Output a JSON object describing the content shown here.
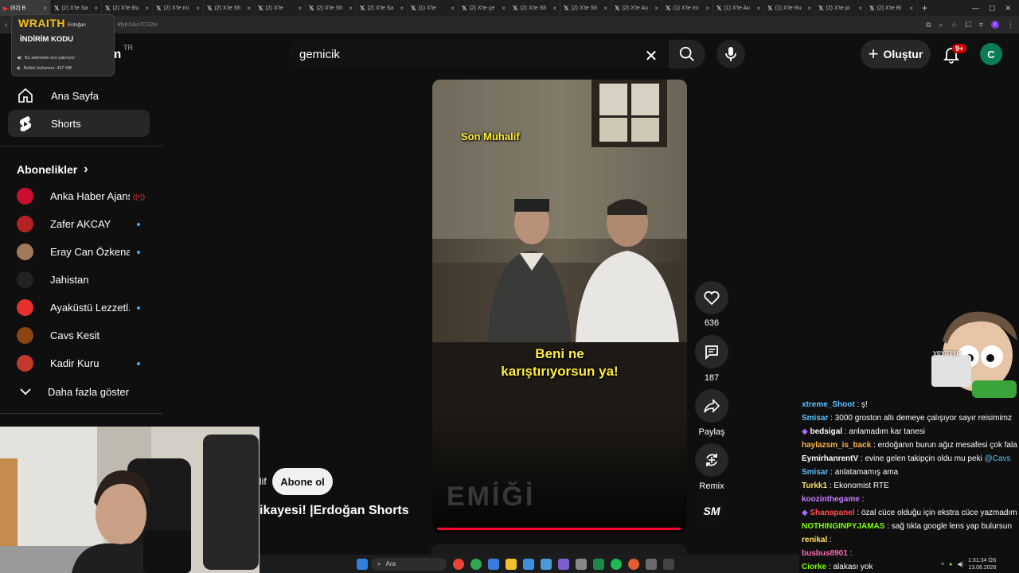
{
  "browser": {
    "tabs": [
      {
        "label": "(62) B",
        "active": true
      },
      {
        "label": "(2) X'te Sa"
      },
      {
        "label": "(2) X'te Bu"
      },
      {
        "label": "(2) X'te mi"
      },
      {
        "label": "(2) X'te Sh"
      },
      {
        "label": "(2) X'te"
      },
      {
        "label": "(2) X'te Sh"
      },
      {
        "label": "(2) X'te Sa"
      },
      {
        "label": "(1) X'te"
      },
      {
        "label": "(2) X'te çe"
      },
      {
        "label": "(2) X'te Sh"
      },
      {
        "label": "(2) X'te Sh"
      },
      {
        "label": "(2) X'te Au"
      },
      {
        "label": "(1) X'te mi"
      },
      {
        "label": "(1) X'te Au"
      },
      {
        "label": "(1) X'te Ru"
      },
      {
        "label": "(2) X'te pi"
      },
      {
        "label": "(2) X'te Bl"
      }
    ],
    "url_fragment": "8fyKDAo7CS2w"
  },
  "tab_tooltip": {
    "brand": "WRAITH",
    "promo": "İNDİRİM KODU",
    "title_fragment": "Erdoğan",
    "row_audio": "Bu sekmede ses çalınıyor",
    "row_memory": "Bellek kullanımı: 437 MB"
  },
  "youtube": {
    "logo_tail": "m",
    "region": "TR",
    "search_query": "gemicik",
    "create_label": "Oluştur",
    "notif_count": "9+",
    "avatar_letter": "C"
  },
  "sidebar": {
    "home_label": "Ana Sayfa",
    "shorts_label": "Shorts",
    "subs_heading": "Abonelikler",
    "subscriptions": [
      {
        "name": "Anka Haber Ajansı",
        "live": true,
        "color": "#c8102e"
      },
      {
        "name": "Zafer AKCAY",
        "dot": true,
        "color": "#b22222"
      },
      {
        "name": "Eray Can Özkenar",
        "dot": true,
        "color": "#a0785a"
      },
      {
        "name": "Jahistan",
        "color": "#222222"
      },
      {
        "name": "Ayaküstü Lezzetl...",
        "dot": true,
        "color": "#e63030"
      },
      {
        "name": "Cavs Kesit",
        "color": "#8b4513"
      },
      {
        "name": "Kadir Kuru",
        "dot": true,
        "color": "#c0392b"
      }
    ],
    "show_more": "Daha fazla göster"
  },
  "short": {
    "caption_top": "Son Muhalif",
    "caption_line1": "Beni ne",
    "caption_line2": "karıştırıyorsun ya!",
    "watermark": "EMİĞİ",
    "channel_fragment": "lif",
    "subscribe_label": "Abone ol",
    "title_fragment": "ikayesi! |Erdoğan Shorts",
    "likes": "636",
    "comments": "187",
    "share_label": "Paylaş",
    "remix_label": "Remix",
    "remix_badge": "SM"
  },
  "chat": {
    "mascot_label": "yevmiye",
    "messages": [
      {
        "user": "xtreme_Shoot",
        "text": "ş!",
        "color": "#5bc0ff"
      },
      {
        "user": "Smisar",
        "text": "3000 groston altı demeye çalışıyor sayır reisimimz",
        "color": "#5bc0ff"
      },
      {
        "user": "bedsigal",
        "text": "anlamadım kar tanesi",
        "color": "#ffffff",
        "badge": true
      },
      {
        "user": "haylazsm_is_back",
        "text": "erdoğanın burun ağız mesafesi çok fala",
        "color": "#ffb347"
      },
      {
        "user": "EymirhanrentV",
        "text": "evine gelen takipçin oldu mu peki",
        "mention": "@Cavs",
        "color": "#ffffff"
      },
      {
        "user": "Smisar",
        "text": "anlatamamış ama",
        "color": "#5bc0ff"
      },
      {
        "user": "Turkk1",
        "text": "Ekonomist RTE",
        "color": "#ffe066"
      },
      {
        "user": "koozinthegame",
        "text": "",
        "color": "#c77dff"
      },
      {
        "user": "Shanapanel",
        "text": "özal cüce olduğu için ekstra cüce yazmadım",
        "color": "#ff4d4d",
        "badge": true
      },
      {
        "user": "NOTHINGINPYJAMAS",
        "text": "sağ tıkla google lens yap bulursun",
        "color": "#7CFC00"
      },
      {
        "user": "renikal",
        "text": "",
        "color": "#ffe066"
      },
      {
        "user": "busbus8901",
        "text": "",
        "color": "#ff69b4"
      },
      {
        "user": "Ciorke",
        "text": "alakası yok",
        "color": "#7CFC00"
      }
    ]
  },
  "taskbar": {
    "search_label": "Ara",
    "time": "1:31:34 ÖS",
    "date": "13.08.2026"
  }
}
